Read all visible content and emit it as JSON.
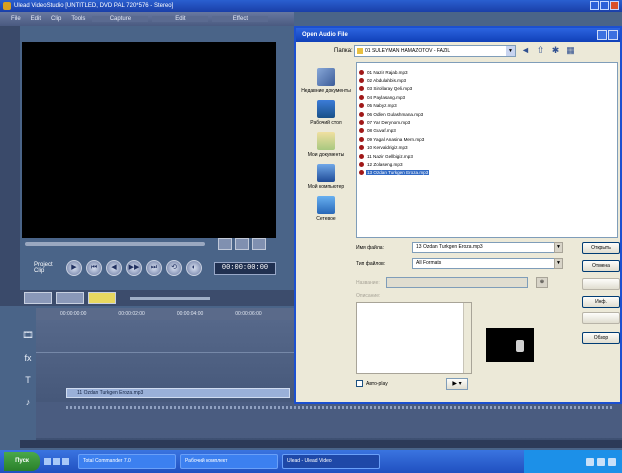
{
  "app": {
    "title": "Ulead VideoStudio [UNTITLED, DVD PAL 720*576 - Stereo]",
    "menu": [
      "File",
      "Edit",
      "Clip",
      "Tools"
    ],
    "steps": [
      "Capture",
      "Edit",
      "Effect"
    ]
  },
  "player": {
    "mode_label": "Project",
    "mode_sub": "Clip",
    "buttons": [
      "▶",
      "⏮",
      "◀",
      "▶▶",
      "⏭",
      "⟲",
      "◐"
    ],
    "timecode": "00:00:00:00"
  },
  "timeline": {
    "ruler": [
      "00:00:00:00",
      "00:00:02:00",
      "00:00:04:00",
      "00:00:06:00"
    ],
    "track_icons": [
      "🎞",
      "fx",
      "T",
      "♪"
    ],
    "audio_clip": "11 Ozdan Turkgen Eroza.mp3"
  },
  "dialog": {
    "title": "Open Audio File",
    "look_in_label": "Папка:",
    "look_in_value": "01 SULEYMAN HAMAZOTOV - FAZIL",
    "places": [
      {
        "icon": "recent",
        "label": "Недавние документы"
      },
      {
        "icon": "desktop",
        "label": "Рабочий стол"
      },
      {
        "icon": "docs",
        "label": "Мои документы"
      },
      {
        "icon": "comp",
        "label": "Мой компьютер"
      },
      {
        "icon": "net",
        "label": "Сетевое"
      }
    ],
    "files": [
      "01 Nazir Rajab.mp3",
      "02 Abdulahbis.mp3",
      "03 Sirollaray Qeli.mp3",
      "04 Paylasang.mp3",
      "05 Nabyz.mp3",
      "06 Odlen Gulashmana.mp3",
      "07 Yar Derynom.mp3",
      "08 Guvaf.mp3",
      "09 Yagal Anasina Mern.mp3",
      "10 Kervaldrigiz.mp3",
      "11 Nazir Gellbigiz.mp3",
      "12 Zolaseng.mp3",
      "13 Ozdan Turkgen Eroza.mp3"
    ],
    "selected_index": 12,
    "file_name_label": "Имя файла:",
    "file_name_value": "13 Ozdan Turkgen Eroza.mp3",
    "file_type_label": "Тип файлов:",
    "file_type_value": "All Formats",
    "subject_label": "Название:",
    "desc_label": "Описание:",
    "buttons": {
      "open": "Открыть",
      "cancel": "Отмена",
      "blank1": "",
      "info": "Инф.",
      "blank2": "",
      "browse": "Обзор"
    },
    "auto_play_label": "Авто-play",
    "play_label": "▶ ▾"
  },
  "taskbar": {
    "start": "Пуск",
    "tasks": [
      "Total Commander 7.0",
      "Рабочий комплект",
      "Ulead - Ulead Video"
    ],
    "active_index": 2
  },
  "colors": {
    "xp_blue": "#1c50d0",
    "selection": "#316ac5",
    "dialog_bg": "#ece9d8",
    "highlight_tool": "#e8d860"
  }
}
